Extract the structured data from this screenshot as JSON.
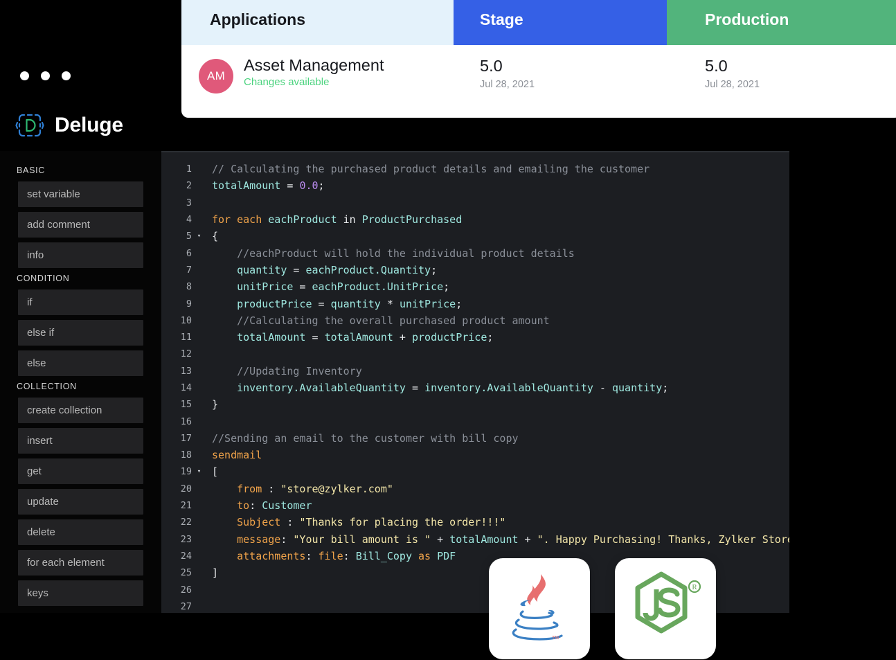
{
  "window": {
    "dots": [
      "dot-1",
      "dot-2",
      "dot-3"
    ],
    "brand_name": "Deluge",
    "brand_icon": "deluge-logo-icon"
  },
  "sidebar": {
    "groups": [
      {
        "label": "BASIC",
        "items": [
          {
            "label": "set variable"
          },
          {
            "label": "add comment"
          },
          {
            "label": "info"
          }
        ]
      },
      {
        "label": "CONDITION",
        "items": [
          {
            "label": "if"
          },
          {
            "label": "else if"
          },
          {
            "label": "else"
          }
        ]
      },
      {
        "label": "COLLECTION",
        "items": [
          {
            "label": "create collection"
          },
          {
            "label": "insert"
          },
          {
            "label": "get"
          },
          {
            "label": "update"
          },
          {
            "label": "delete"
          },
          {
            "label": "for each element"
          },
          {
            "label": "keys"
          }
        ]
      }
    ]
  },
  "editor": {
    "language": "Deluge",
    "first_line": 1,
    "last_line": 27,
    "lines": [
      {
        "n": "1",
        "fold": "",
        "tokens": [
          {
            "t": "// Calculating the purchased product details and emailing the customer",
            "c": "c-com"
          }
        ]
      },
      {
        "n": "2",
        "fold": "",
        "tokens": [
          {
            "t": "totalAmount",
            "c": "c-var"
          },
          {
            "t": " = ",
            "c": "c-op"
          },
          {
            "t": "0.0",
            "c": "c-num"
          },
          {
            "t": ";",
            "c": "c-op"
          }
        ]
      },
      {
        "n": "3",
        "fold": "",
        "tokens": []
      },
      {
        "n": "4",
        "fold": "",
        "tokens": [
          {
            "t": "for each",
            "c": "c-kw"
          },
          {
            "t": " ",
            "c": "c-op"
          },
          {
            "t": "eachProduct",
            "c": "c-var"
          },
          {
            "t": " in ",
            "c": "c-op"
          },
          {
            "t": "ProductPurchased",
            "c": "c-type"
          }
        ]
      },
      {
        "n": "5",
        "fold": "▾",
        "tokens": [
          {
            "t": "{",
            "c": "c-pl"
          }
        ]
      },
      {
        "n": "6",
        "fold": "",
        "tokens": [
          {
            "t": "    //eachProduct will hold the individual product details",
            "c": "c-com"
          }
        ]
      },
      {
        "n": "7",
        "fold": "",
        "tokens": [
          {
            "t": "    ",
            "c": "c-op"
          },
          {
            "t": "quantity",
            "c": "c-var"
          },
          {
            "t": " = ",
            "c": "c-op"
          },
          {
            "t": "eachProduct.Quantity",
            "c": "c-var"
          },
          {
            "t": ";",
            "c": "c-op"
          }
        ]
      },
      {
        "n": "8",
        "fold": "",
        "tokens": [
          {
            "t": "    ",
            "c": "c-op"
          },
          {
            "t": "unitPrice",
            "c": "c-var"
          },
          {
            "t": " = ",
            "c": "c-op"
          },
          {
            "t": "eachProduct.UnitPrice",
            "c": "c-var"
          },
          {
            "t": ";",
            "c": "c-op"
          }
        ]
      },
      {
        "n": "9",
        "fold": "",
        "tokens": [
          {
            "t": "    ",
            "c": "c-op"
          },
          {
            "t": "productPrice",
            "c": "c-var"
          },
          {
            "t": " = ",
            "c": "c-op"
          },
          {
            "t": "quantity",
            "c": "c-var"
          },
          {
            "t": " * ",
            "c": "c-op"
          },
          {
            "t": "unitPrice",
            "c": "c-var"
          },
          {
            "t": ";",
            "c": "c-op"
          }
        ]
      },
      {
        "n": "10",
        "fold": "",
        "tokens": [
          {
            "t": "    //Calculating the overall purchased product amount",
            "c": "c-com"
          }
        ]
      },
      {
        "n": "11",
        "fold": "",
        "tokens": [
          {
            "t": "    ",
            "c": "c-op"
          },
          {
            "t": "totalAmount",
            "c": "c-var"
          },
          {
            "t": " = ",
            "c": "c-op"
          },
          {
            "t": "totalAmount",
            "c": "c-var"
          },
          {
            "t": " + ",
            "c": "c-op"
          },
          {
            "t": "productPrice",
            "c": "c-var"
          },
          {
            "t": ";",
            "c": "c-op"
          }
        ]
      },
      {
        "n": "12",
        "fold": "",
        "tokens": []
      },
      {
        "n": "13",
        "fold": "",
        "tokens": [
          {
            "t": "    //Updating Inventory",
            "c": "c-com"
          }
        ]
      },
      {
        "n": "14",
        "fold": "",
        "tokens": [
          {
            "t": "    ",
            "c": "c-op"
          },
          {
            "t": "inventory.AvailableQuantity",
            "c": "c-var"
          },
          {
            "t": " = ",
            "c": "c-op"
          },
          {
            "t": "inventory.AvailableQuantity",
            "c": "c-var"
          },
          {
            "t": " - ",
            "c": "c-op"
          },
          {
            "t": "quantity",
            "c": "c-var"
          },
          {
            "t": ";",
            "c": "c-op"
          }
        ]
      },
      {
        "n": "15",
        "fold": "",
        "tokens": [
          {
            "t": "}",
            "c": "c-pl"
          }
        ]
      },
      {
        "n": "16",
        "fold": "",
        "tokens": []
      },
      {
        "n": "17",
        "fold": "",
        "tokens": [
          {
            "t": "//Sending an email to the customer with bill copy",
            "c": "c-com"
          }
        ]
      },
      {
        "n": "18",
        "fold": "",
        "tokens": [
          {
            "t": "sendmail",
            "c": "c-kw"
          }
        ]
      },
      {
        "n": "19",
        "fold": "▾",
        "tokens": [
          {
            "t": "[",
            "c": "c-pl"
          }
        ]
      },
      {
        "n": "20",
        "fold": "",
        "tokens": [
          {
            "t": "    ",
            "c": "c-op"
          },
          {
            "t": "from",
            "c": "c-kw"
          },
          {
            "t": " : ",
            "c": "c-op"
          },
          {
            "t": "\"store@zylker.com\"",
            "c": "c-str"
          }
        ]
      },
      {
        "n": "21",
        "fold": "",
        "tokens": [
          {
            "t": "    ",
            "c": "c-op"
          },
          {
            "t": "to",
            "c": "c-kw"
          },
          {
            "t": ": ",
            "c": "c-op"
          },
          {
            "t": "Customer",
            "c": "c-var"
          }
        ]
      },
      {
        "n": "22",
        "fold": "",
        "tokens": [
          {
            "t": "    ",
            "c": "c-op"
          },
          {
            "t": "Subject",
            "c": "c-kw"
          },
          {
            "t": " : ",
            "c": "c-op"
          },
          {
            "t": "\"Thanks for placing the order!!!\"",
            "c": "c-str"
          }
        ]
      },
      {
        "n": "23",
        "fold": "",
        "tokens": [
          {
            "t": "    ",
            "c": "c-op"
          },
          {
            "t": "message",
            "c": "c-kw"
          },
          {
            "t": ": ",
            "c": "c-op"
          },
          {
            "t": "\"Your bill amount is \"",
            "c": "c-str"
          },
          {
            "t": " + ",
            "c": "c-op"
          },
          {
            "t": "totalAmount",
            "c": "c-var"
          },
          {
            "t": " + ",
            "c": "c-op"
          },
          {
            "t": "\". Happy Purchasing! Thanks, Zylker Store\"",
            "c": "c-str"
          }
        ]
      },
      {
        "n": "24",
        "fold": "",
        "tokens": [
          {
            "t": "    ",
            "c": "c-op"
          },
          {
            "t": "attachments",
            "c": "c-kw"
          },
          {
            "t": ": ",
            "c": "c-op"
          },
          {
            "t": "file",
            "c": "c-kw"
          },
          {
            "t": ": ",
            "c": "c-op"
          },
          {
            "t": "Bill_Copy",
            "c": "c-var"
          },
          {
            "t": " as ",
            "c": "c-kw"
          },
          {
            "t": "PDF",
            "c": "c-var"
          }
        ]
      },
      {
        "n": "25",
        "fold": "",
        "tokens": [
          {
            "t": "]",
            "c": "c-pl"
          }
        ]
      },
      {
        "n": "26",
        "fold": "",
        "tokens": []
      },
      {
        "n": "27",
        "fold": "",
        "tokens": []
      }
    ]
  },
  "app_card": {
    "columns": [
      {
        "key": "applications",
        "label": "Applications",
        "bg": "#e4f2fb"
      },
      {
        "key": "stage",
        "label": "Stage",
        "bg": "#3560e6"
      },
      {
        "key": "production",
        "label": "Production",
        "bg": "#52b47c"
      }
    ],
    "row": {
      "avatar_initials": "AM",
      "avatar_color": "#e0597a",
      "app_name": "Asset Management",
      "status_text": "Changes available",
      "status_color": "#4cd37f",
      "stage_version": "5.0",
      "stage_date": "Jul 28, 2021",
      "production_version": "5.0",
      "production_date": "Jul 28, 2021"
    }
  },
  "language_badges": [
    {
      "name": "java-logo-icon",
      "label": "Java"
    },
    {
      "name": "nodejs-logo-icon",
      "label": "Node.js"
    }
  ],
  "colors": {
    "accent_blue": "#3560e6",
    "accent_green": "#52b47c",
    "avatar_pink": "#e0597a",
    "status_green": "#4cd37f",
    "editor_bg": "#1c1e22",
    "sidebar_bg": "#050505"
  }
}
